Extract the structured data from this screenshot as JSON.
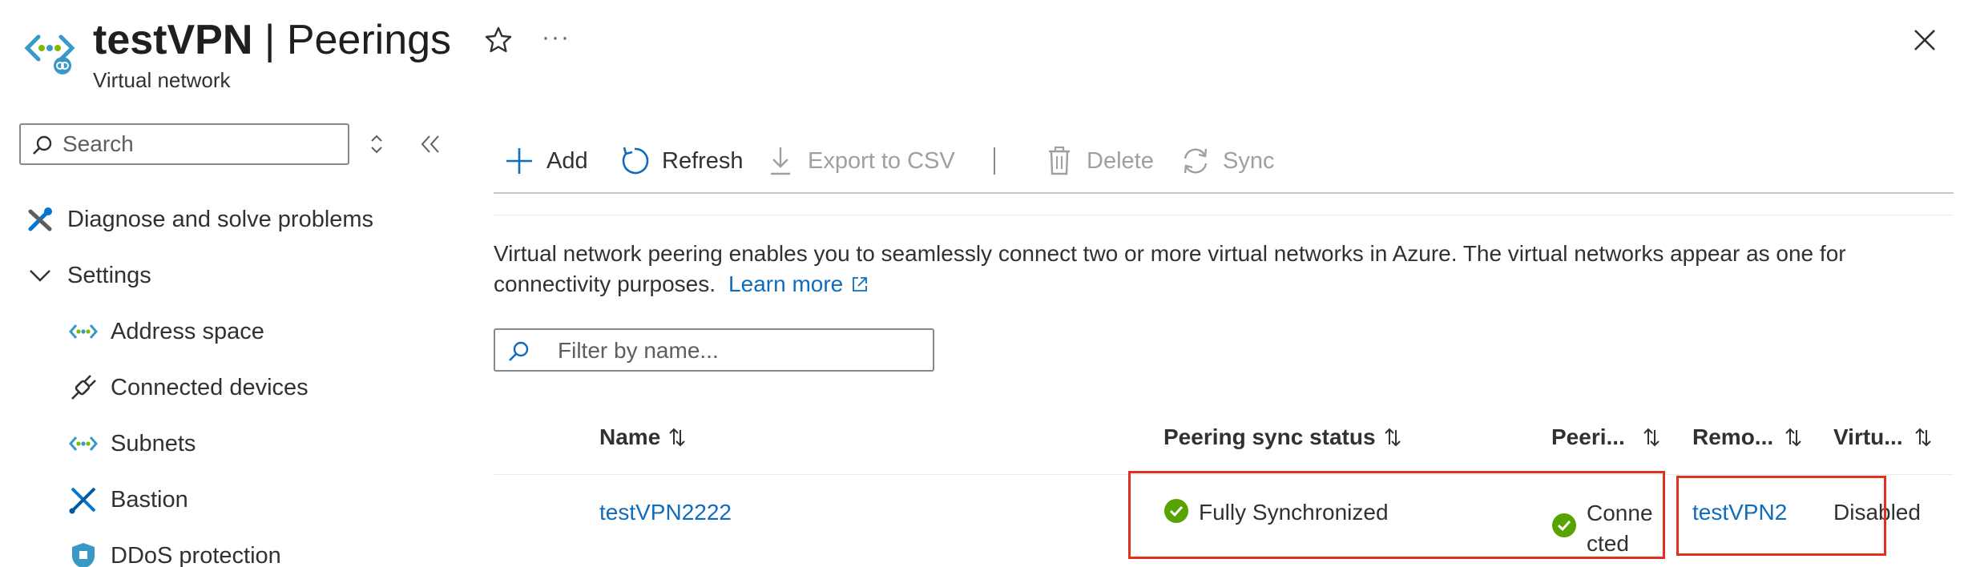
{
  "header": {
    "resource_name": "testVPN",
    "separator": " | ",
    "blade_title": "Peerings",
    "subtitle": "Virtual network",
    "more_label": "···"
  },
  "sidebar": {
    "search_placeholder": "Search",
    "items": [
      {
        "label": "Diagnose and solve problems",
        "icon": "wrench-icon"
      },
      {
        "label": "Settings",
        "icon": "chevron-down-icon"
      },
      {
        "label": "Address space",
        "icon": "address-space-icon"
      },
      {
        "label": "Connected devices",
        "icon": "plug-icon"
      },
      {
        "label": "Subnets",
        "icon": "subnets-icon"
      },
      {
        "label": "Bastion",
        "icon": "bastion-icon"
      },
      {
        "label": "DDoS protection",
        "icon": "shield-icon"
      }
    ]
  },
  "toolbar": {
    "add": "Add",
    "refresh": "Refresh",
    "export": "Export to CSV",
    "delete": "Delete",
    "sync": "Sync"
  },
  "description": {
    "text": "Virtual network peering enables you to seamlessly connect two or more virtual networks in Azure. The virtual networks appear as one for connectivity purposes.",
    "link": "Learn more"
  },
  "filter": {
    "placeholder": "Filter by name..."
  },
  "table": {
    "columns": [
      "Name",
      "Peering sync status",
      "Peeri...",
      "Remo...",
      "Virtu..."
    ],
    "rows": [
      {
        "name": "testVPN2222",
        "sync_status": "Fully Synchronized",
        "peering_status": "Connected",
        "remote": "testVPN2",
        "virtual": "Disabled"
      }
    ]
  },
  "colors": {
    "accent": "#0f6cbd",
    "success": "#57a300",
    "highlight": "#e0301e"
  }
}
